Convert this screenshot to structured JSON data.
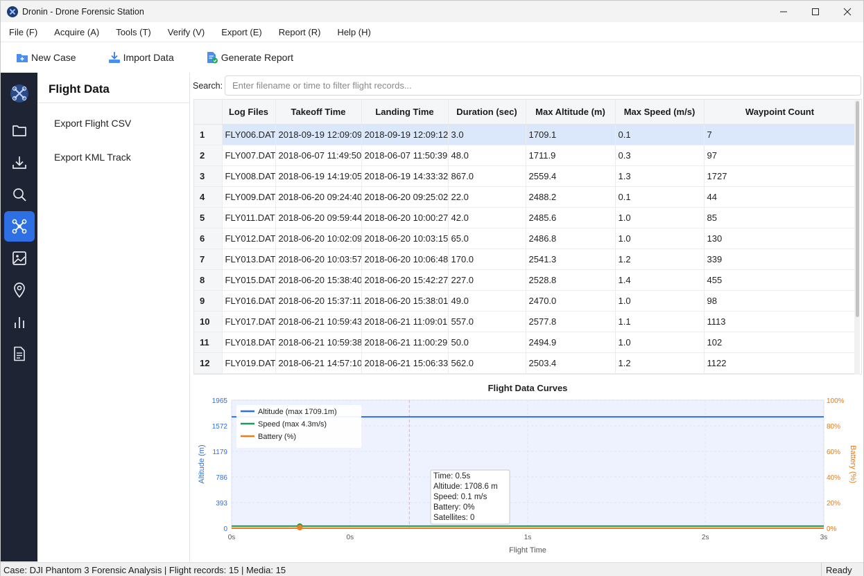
{
  "window": {
    "title": "Dronin - Drone Forensic Station"
  },
  "menu": [
    "File (F)",
    "Acquire (A)",
    "Tools (T)",
    "Verify (V)",
    "Export (E)",
    "Report (R)",
    "Help (H)"
  ],
  "toolbar": {
    "new_case": "New Case",
    "import_data": "Import Data",
    "generate_report": "Generate Report"
  },
  "rail": [
    "drone-logo-icon",
    "folder-icon",
    "download-icon",
    "search-icon",
    "drone-icon",
    "image-icon",
    "map-pin-icon",
    "bar-chart-icon",
    "document-icon"
  ],
  "side": {
    "title": "Flight Data",
    "items": [
      "Export Flight CSV",
      "Export KML Track"
    ]
  },
  "search": {
    "label": "Search:",
    "placeholder": "Enter filename or time to filter flight records..."
  },
  "table": {
    "headers": [
      "",
      "Log Files",
      "Takeoff Time",
      "Landing Time",
      "Duration (sec)",
      "Max Altitude (m)",
      "Max Speed (m/s)",
      "Waypoint Count"
    ],
    "rows": [
      [
        "1",
        "FLY006.DAT",
        "2018-09-19 12:09:09",
        "2018-09-19 12:09:12",
        "3.0",
        "1709.1",
        "0.1",
        "7"
      ],
      [
        "2",
        "FLY007.DAT",
        "2018-06-07 11:49:50",
        "2018-06-07 11:50:39",
        "48.0",
        "1711.9",
        "0.3",
        "97"
      ],
      [
        "3",
        "FLY008.DAT",
        "2018-06-19 14:19:05",
        "2018-06-19 14:33:32",
        "867.0",
        "2559.4",
        "1.3",
        "1727"
      ],
      [
        "4",
        "FLY009.DAT",
        "2018-06-20 09:24:40",
        "2018-06-20 09:25:02",
        "22.0",
        "2488.2",
        "0.1",
        "44"
      ],
      [
        "5",
        "FLY011.DAT",
        "2018-06-20 09:59:44",
        "2018-06-20 10:00:27",
        "42.0",
        "2485.6",
        "1.0",
        "85"
      ],
      [
        "6",
        "FLY012.DAT",
        "2018-06-20 10:02:09",
        "2018-06-20 10:03:15",
        "65.0",
        "2486.8",
        "1.0",
        "130"
      ],
      [
        "7",
        "FLY013.DAT",
        "2018-06-20 10:03:57",
        "2018-06-20 10:06:48",
        "170.0",
        "2541.3",
        "1.2",
        "339"
      ],
      [
        "8",
        "FLY015.DAT",
        "2018-06-20 15:38:40",
        "2018-06-20 15:42:27",
        "227.0",
        "2528.8",
        "1.4",
        "455"
      ],
      [
        "9",
        "FLY016.DAT",
        "2018-06-20 15:37:11",
        "2018-06-20 15:38:01",
        "49.0",
        "2470.0",
        "1.0",
        "98"
      ],
      [
        "10",
        "FLY017.DAT",
        "2018-06-21 10:59:43",
        "2018-06-21 11:09:01",
        "557.0",
        "2577.8",
        "1.1",
        "1113"
      ],
      [
        "11",
        "FLY018.DAT",
        "2018-06-21 10:59:38",
        "2018-06-21 11:00:29",
        "50.0",
        "2494.9",
        "1.0",
        "102"
      ],
      [
        "12",
        "FLY019.DAT",
        "2018-06-21 14:57:10",
        "2018-06-21 15:06:33",
        "562.0",
        "2503.4",
        "1.2",
        "1122"
      ],
      [
        "13",
        "",
        "",
        "",
        "",
        "",
        "",
        ""
      ]
    ]
  },
  "chart_data": {
    "type": "line",
    "title": "Flight Data Curves",
    "xlabel": "Flight Time",
    "ylabel": "Altitude (m)",
    "y2label": "Battery (%)",
    "x_ticks": [
      "0s",
      "0s",
      "1s",
      "2s",
      "3s"
    ],
    "y_ticks": [
      "0",
      "393",
      "786",
      "1179",
      "1572",
      "1965"
    ],
    "y2_ticks": [
      "0%",
      "20%",
      "40%",
      "60%",
      "80%",
      "100%"
    ],
    "ylim": [
      0,
      1965
    ],
    "y2lim": [
      0,
      100
    ],
    "xlim": [
      0,
      3
    ],
    "legend_position": "top-left",
    "series": [
      {
        "name": "Altitude (max 1709.1m)",
        "color": "#2f6fe4",
        "x": [
          0,
          0.5,
          1,
          1.5,
          2,
          2.5,
          3
        ],
        "y": [
          1708.6,
          1708.6,
          1709.0,
          1709.1,
          1709.1,
          1709.0,
          1709.0
        ]
      },
      {
        "name": "Speed (max 4.3m/s)",
        "color": "#1a9a5a",
        "x": [
          0,
          0.5,
          1,
          1.5,
          2,
          2.5,
          3
        ],
        "y": [
          0.1,
          0.1,
          0.1,
          0.1,
          0.1,
          0.1,
          0.1
        ]
      },
      {
        "name": "Battery (%)",
        "color": "#f07d1a",
        "x": [
          0,
          0.5,
          1,
          1.5,
          2,
          2.5,
          3
        ],
        "y": [
          0,
          0,
          0,
          0,
          0,
          0,
          0
        ]
      }
    ],
    "tooltip": {
      "x": 0.5,
      "lines": [
        "Time: 0.5s",
        "Altitude: 1708.6 m",
        "Speed: 0.1 m/s",
        "Battery: 0%",
        "Satellites: 0"
      ]
    }
  },
  "status": {
    "left": "Case: DJI Phantom 3 Forensic Analysis | Flight records: 15 | Media: 15",
    "right": "Ready"
  },
  "colors": {
    "rail_bg": "#1e2433",
    "accent": "#2f6fe4",
    "altitude": "#2f6fe4",
    "speed": "#1a9a5a",
    "battery": "#f07d1a",
    "selected_row": "#dbe7fb"
  }
}
